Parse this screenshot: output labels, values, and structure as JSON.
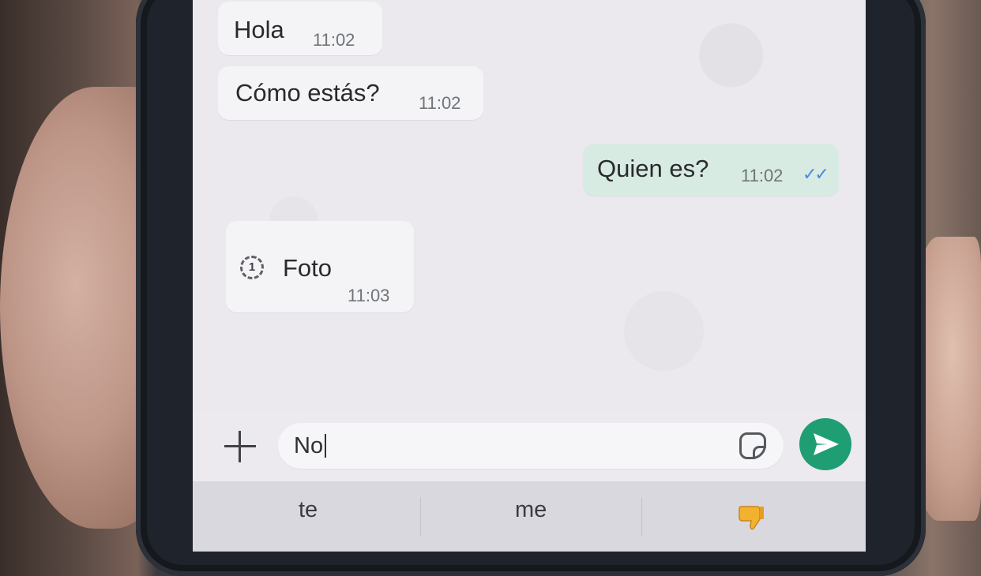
{
  "messages": [
    {
      "direction": "incoming",
      "text": "Hola",
      "time": "11:02"
    },
    {
      "direction": "incoming",
      "text": "Cómo estás?",
      "time": "11:02"
    },
    {
      "direction": "outgoing",
      "text": "Quien es?",
      "time": "11:02",
      "status_icon": "double-check-read-icon"
    },
    {
      "direction": "incoming",
      "text": "Foto",
      "time": "11:03",
      "view_once_counter": "1",
      "icon": "view-once-icon"
    }
  ],
  "composer": {
    "value": "No",
    "icons": [
      "plus-icon",
      "sticker-icon",
      "send-icon"
    ]
  },
  "suggestions": {
    "items": [
      "te",
      "me"
    ],
    "emoji_icon": "thumbs-down-emoji-icon"
  },
  "colors": {
    "send_button": "#1f9e74",
    "outgoing_bubble": "#d8ebe2",
    "read_ticks": "#4d86e0"
  }
}
